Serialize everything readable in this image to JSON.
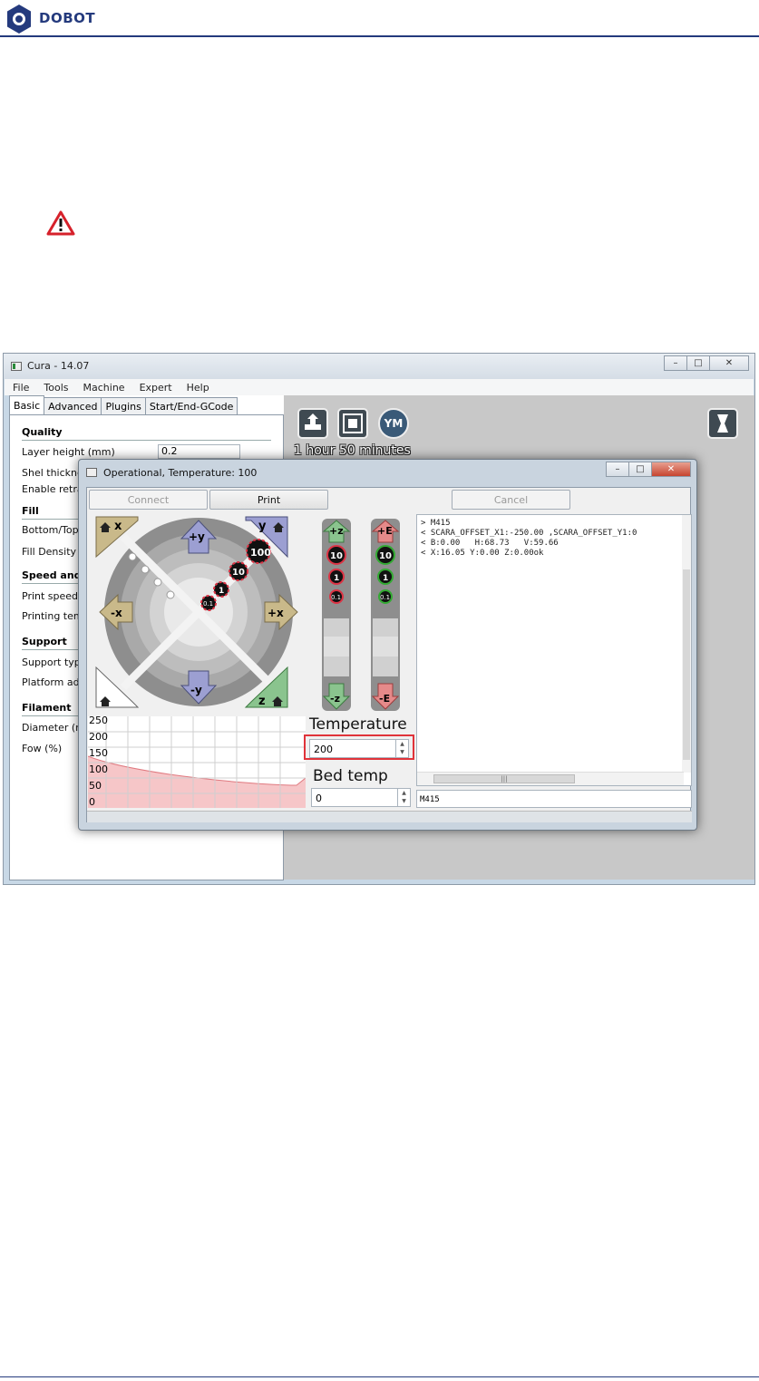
{
  "doc": {
    "brand": "DOBOT",
    "colors": {
      "brand": "#243a7d",
      "warning": "#d6212b"
    },
    "icons": {
      "logo": "dobot-logo-icon",
      "warning": "warning-triangle-icon"
    }
  },
  "cura": {
    "title": "Cura - 14.07",
    "window_buttons": {
      "minimize": "–",
      "maximize": "□",
      "close": "✕"
    },
    "menu": [
      "File",
      "Tools",
      "Machine",
      "Expert",
      "Help"
    ],
    "tabs": [
      "Basic",
      "Advanced",
      "Plugins",
      "Start/End-GCode"
    ],
    "active_tab": "Basic",
    "sections": {
      "quality": "Quality",
      "fill": "Fill",
      "speed": "Speed and",
      "support": "Support",
      "filament": "Filament"
    },
    "settings": {
      "layer_height_label": "Layer height (mm)",
      "layer_height_value": "0.2",
      "shell_thickness_label": "Shel thickne",
      "enable_retraction_label": "Enable retrac",
      "bottom_top_label": "Bottom/Top",
      "fill_density_label": "Fill Density (%",
      "print_speed_label": "Print speed (",
      "printing_temp_label": "Printing temp",
      "support_type_label": "Support type",
      "platform_adhesion_label": "Platform adh",
      "diameter_label": "Diameter (m",
      "flow_label": "Fow (%)"
    },
    "viewport": {
      "print_time": "1 hour 50 minutes",
      "icons": [
        "load-model-icon",
        "print-icon",
        "youmagine-icon",
        "view-mode-icon"
      ],
      "youmagine_label": "YM"
    }
  },
  "dialog": {
    "title": "Operational, Temperature: 100",
    "buttons": {
      "connect": "Connect",
      "print": "Print",
      "cancel": "Cancel"
    },
    "jog": {
      "home_x": "x",
      "home_y": "y",
      "home_z": "z",
      "plus_y": "+y",
      "minus_y": "-y",
      "plus_x": "+x",
      "minus_x": "-x",
      "steps": [
        "100",
        "10",
        "1",
        "0.1"
      ]
    },
    "z_column": {
      "up": "+z",
      "down": "-z",
      "steps": [
        "10",
        "1",
        "0.1"
      ]
    },
    "e_column": {
      "up": "+E",
      "down": "-E",
      "steps": [
        "10",
        "1",
        "0.1"
      ]
    },
    "graph": {
      "y_ticks": [
        "250",
        "200",
        "150",
        "100",
        "50",
        "0"
      ]
    },
    "temperature": {
      "label": "Temperature",
      "value": "200"
    },
    "bed_temp": {
      "label": "Bed temp",
      "value": "0"
    },
    "console_lines": [
      "> M415",
      "< SCARA_OFFSET_X1:-250.00 ,SCARA_OFFSET_Y1:0",
      "< B:0.00   H:68.73   V:59.66",
      "< X:16.05 Y:0.00 Z:0.00ok"
    ],
    "command_input": "M415"
  }
}
